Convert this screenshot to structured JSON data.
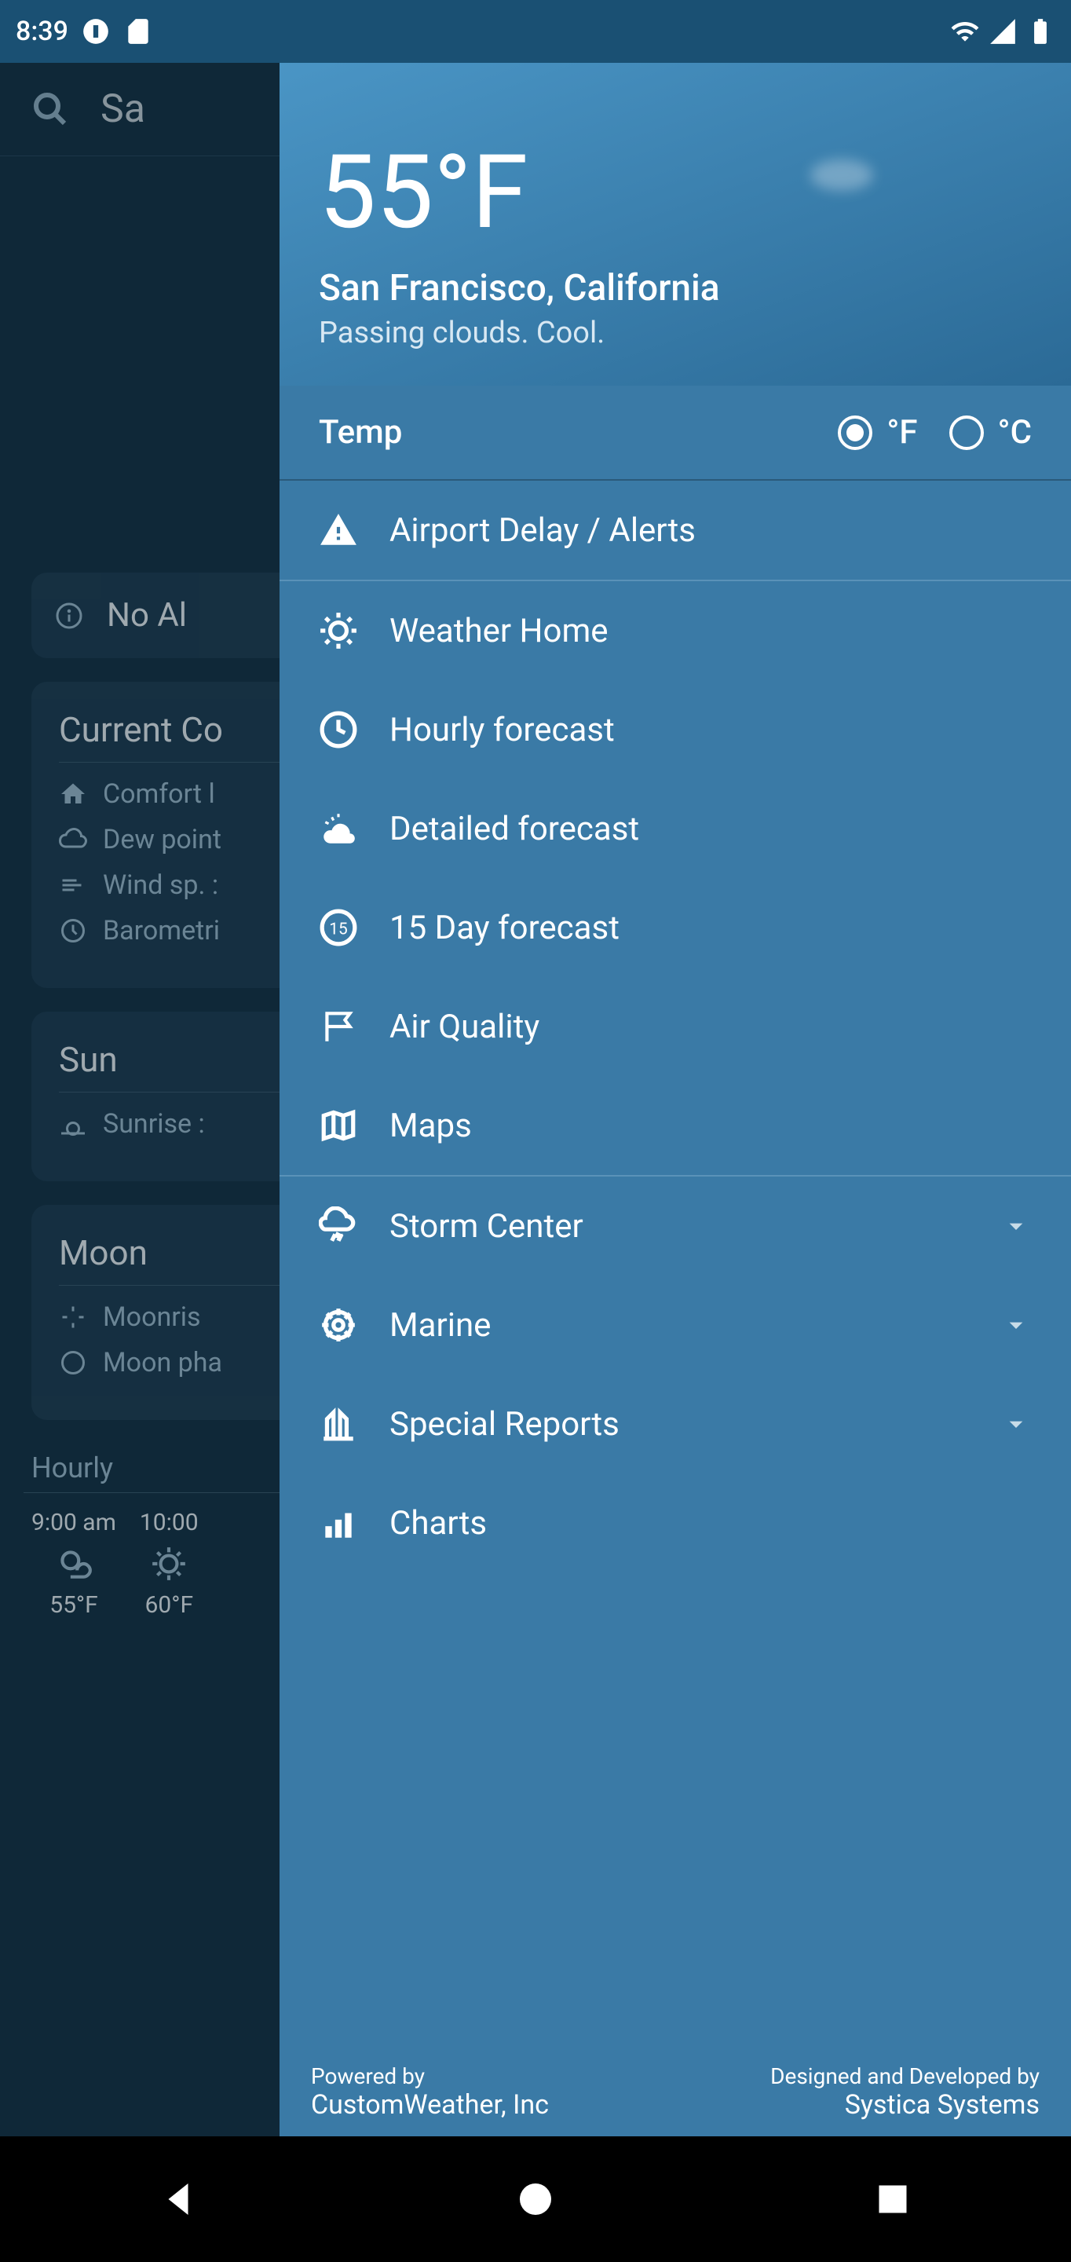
{
  "status": {
    "time": "8:39"
  },
  "background": {
    "search_location": "Sa",
    "alert_text": "No Al",
    "current_conditions": {
      "title": "Current Co",
      "comfort": "Comfort l",
      "dew": "Dew point",
      "wind": "Wind sp. :",
      "baro": "Barometri"
    },
    "sun": {
      "title": "Sun",
      "sunrise": "Sunrise : "
    },
    "moon": {
      "title": "Moon",
      "moonrise": "Moonris",
      "phase": "Moon pha"
    },
    "hourly": {
      "title": "Hourly",
      "items": [
        {
          "time": "9:00 am",
          "temp": "55°F"
        },
        {
          "time": "10:00",
          "temp": "60°F"
        }
      ]
    }
  },
  "drawer": {
    "temperature": "55°F",
    "location": "San Francisco, California",
    "condition": "Passing clouds. Cool.",
    "temp_toggle": {
      "label": "Temp",
      "unit_f": "°F",
      "unit_c": "°C",
      "selected": "F"
    },
    "menu": {
      "airport_delay": "Airport Delay / Alerts",
      "weather_home": "Weather Home",
      "hourly_forecast": "Hourly forecast",
      "detailed_forecast": "Detailed forecast",
      "day15_forecast": "15 Day forecast",
      "air_quality": "Air Quality",
      "maps": "Maps",
      "storm_center": "Storm Center",
      "marine": "Marine",
      "special_reports": "Special Reports",
      "charts": "Charts"
    },
    "footer": {
      "powered_label": "Powered by",
      "powered_name": "CustomWeather, Inc",
      "designed_label": "Designed and Developed by",
      "designed_name": "Systica Systems"
    }
  }
}
